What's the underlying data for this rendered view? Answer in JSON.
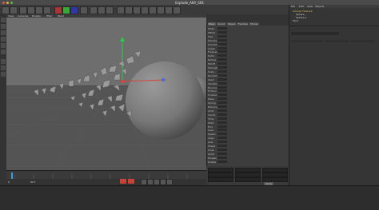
{
  "window": {
    "title": "Explode_ANY_SEE"
  },
  "toolbar": {
    "icons": [
      "undo-icon",
      "redo-icon",
      "select-icon",
      "move-icon",
      "scale-icon",
      "rotate-icon",
      "recent-icon",
      "x-axis-icon",
      "y-axis-icon",
      "z-axis-icon",
      "world-icon",
      "render-icon",
      "render-view-icon",
      "render-settings-icon",
      "cube-icon",
      "spline-icon",
      "nurbs-icon",
      "array-icon",
      "deformer-icon",
      "scene-icon",
      "camera-icon",
      "light-icon"
    ]
  },
  "viewport": {
    "menu": [
      "View",
      "Cameras",
      "Display",
      "Filter",
      "Panel"
    ],
    "colors": {
      "background": "#6a6a6a",
      "sphere": "#7b7b7b",
      "x_axis": "#d8443a",
      "y_axis": "#2ec84a",
      "z_axis": "#3b6ee0"
    }
  },
  "timeline": {
    "frame_start": "0",
    "frame_end": "90 F"
  },
  "attributes": {
    "tabs": [
      "Basic",
      "Coord.",
      "Object",
      "Fracture",
      "Forces",
      "Sort",
      "Display"
    ],
    "rows": [
      "Mode",
      "Offset",
      "Size",
      "Density",
      "Smoothing",
      "Angle",
      "Frequency",
      "Delta",
      "Radius",
      "Falloff",
      "Strength",
      "Scale",
      "Random",
      "Seed",
      "Variation",
      "Bounce",
      "Friction",
      "Collision",
      "Mass",
      "Spring",
      "Damping",
      "Limit",
      "Cache",
      "Time",
      "Start",
      "End",
      "Loop",
      "Speed",
      "Align",
      "Axis",
      "Shape",
      "Inner",
      "Outer",
      "Display",
      "Enable"
    ]
  },
  "object_manager": {
    "items": [
      "Voronoi Fracture",
      "Sphere",
      "Sphere.1",
      "Floor"
    ],
    "menu": [
      "File",
      "Edit",
      "View",
      "Objects",
      "Tags",
      "Bookmarks"
    ]
  },
  "coordinates": {
    "apply_label": "Apply"
  }
}
